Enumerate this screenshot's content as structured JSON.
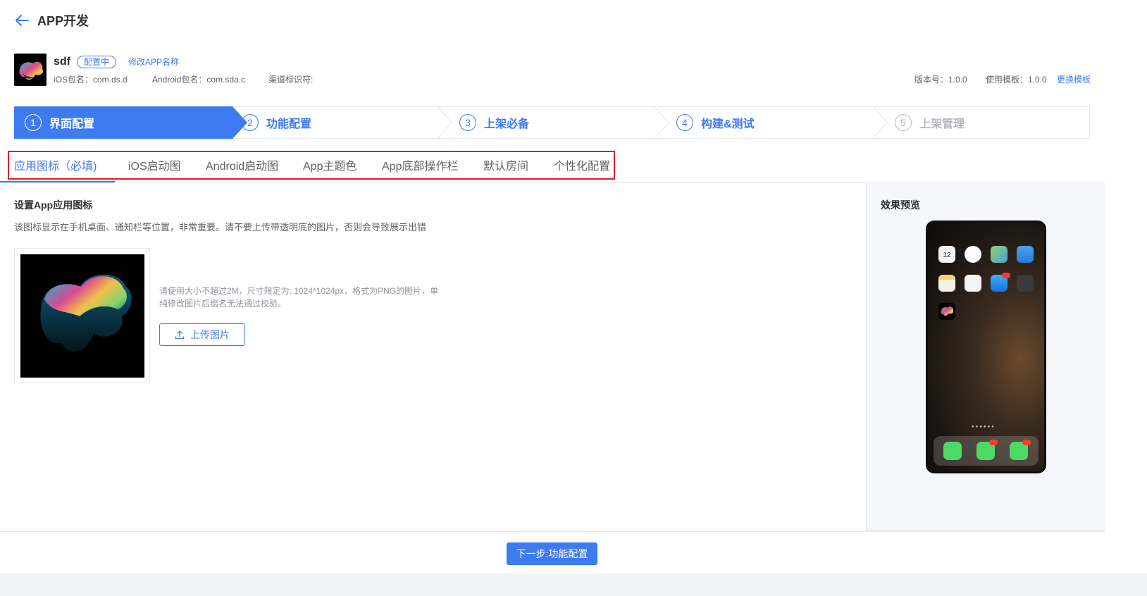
{
  "header": {
    "title": "APP开发",
    "back_icon": "arrow-left-icon"
  },
  "app": {
    "name": "sdf",
    "status": "配置中",
    "rename_label": "修改APP名称",
    "ios_package": "iOS包名：com.ds.d",
    "android_package": "Android包名：com.sda.c",
    "channel": "渠道标识符:",
    "version": "版本号：1.0.0",
    "template_version": "使用模板：1.0.0",
    "change_template_label": "更换模板"
  },
  "steps": [
    {
      "num": "1",
      "label": "界面配置",
      "state": "active"
    },
    {
      "num": "2",
      "label": "功能配置",
      "state": "pending"
    },
    {
      "num": "3",
      "label": "上架必备",
      "state": "pending"
    },
    {
      "num": "4",
      "label": "构建&测试",
      "state": "pending"
    },
    {
      "num": "5",
      "label": "上架管理",
      "state": "disabled"
    }
  ],
  "tabs": [
    {
      "label": "应用图标（必填)",
      "active": true
    },
    {
      "label": "iOS启动图"
    },
    {
      "label": "Android启动图"
    },
    {
      "label": "App主题色"
    },
    {
      "label": "App底部操作栏"
    },
    {
      "label": "默认房间"
    },
    {
      "label": "个性化配置"
    }
  ],
  "content": {
    "title": "设置App应用图标",
    "description": "该图标显示在手机桌面、通知栏等位置，非常重要。请不要上传带透明底的图片，否则会导致展示出错",
    "hint": "请使用大小不超过2M，尺寸限定为: 1024*1024px，格式为PNG的图片，单纯修改图片后缀名无法通过校验。",
    "upload_label": "上传图片",
    "upload_icon": "upload-icon"
  },
  "preview": {
    "title": "效果预览",
    "clock_date": "12"
  },
  "footer": {
    "next_label": "下一步:功能配置"
  },
  "colors": {
    "primary": "#3c7bf0",
    "highlight": "#e0192b",
    "disabled": "#b4b7bd"
  }
}
